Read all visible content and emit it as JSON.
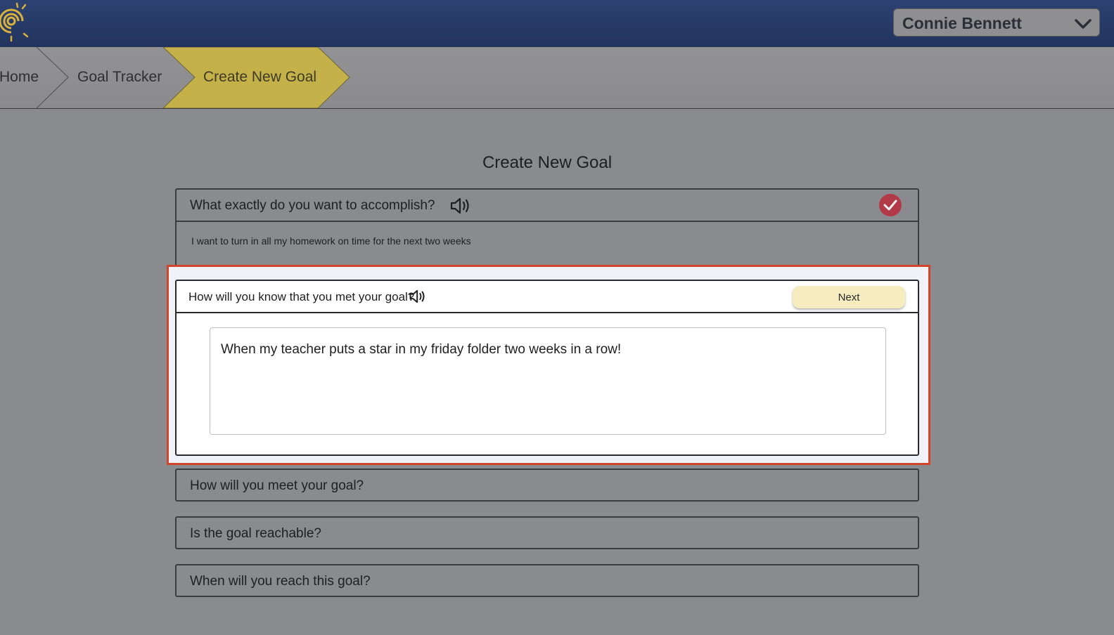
{
  "header": {
    "user_name": "Connie Bennett"
  },
  "breadcrumb": {
    "items": [
      "Home",
      "Goal Tracker",
      "Create New Goal"
    ],
    "active_color": "#c5b14a"
  },
  "page": {
    "title": "Create New Goal"
  },
  "steps": [
    {
      "question": "What exactly do you want to accomplish?",
      "answer": "I want to turn in all my homework on time for the next two weeks",
      "status": "complete"
    },
    {
      "question": "How will you know that you met your goal?",
      "answer": "When my teacher puts a star in my friday folder two weeks in a row!",
      "button_label": "Next",
      "status": "active"
    },
    {
      "question": "How will you meet your goal?"
    },
    {
      "question": "Is the goal reachable?"
    },
    {
      "question": "When will you reach this goal?"
    }
  ],
  "colors": {
    "topbar": "#22335d",
    "highlight_border": "#d2452c",
    "check": "#b23a48",
    "next_button": "#f7ebc0"
  }
}
